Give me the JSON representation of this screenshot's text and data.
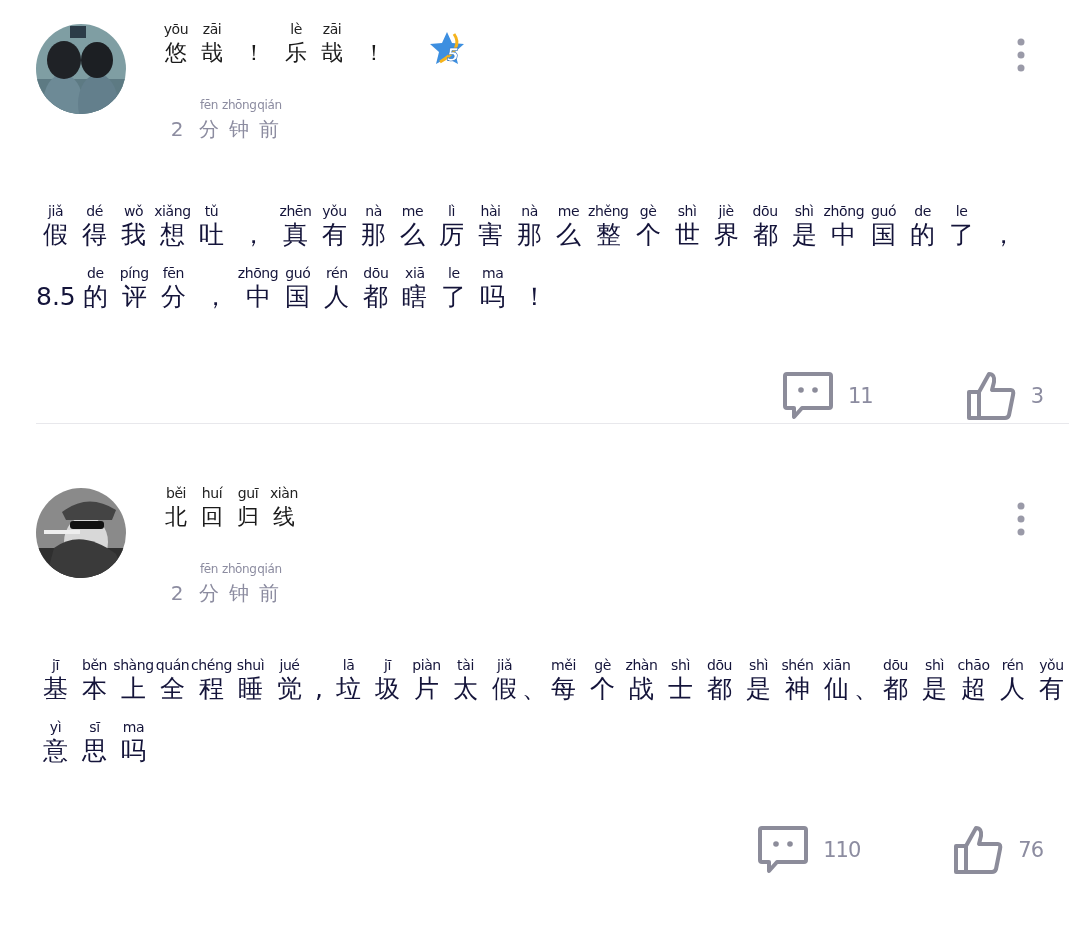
{
  "comments": [
    {
      "avatar": {
        "kind": "picture"
      },
      "name": [
        [
          "yōu",
          "悠"
        ],
        [
          "zāi",
          "哉"
        ],
        [
          "！"
        ],
        [
          "lè",
          "乐"
        ],
        [
          "zāi",
          "哉"
        ],
        [
          "！"
        ]
      ],
      "level_badge": "5",
      "time": [
        [
          "2"
        ],
        [
          "fēn",
          "分"
        ],
        [
          "zhōng",
          "钟"
        ],
        [
          "qián",
          "前"
        ]
      ],
      "text_lines": [
        [
          [
            "jiǎ",
            "假"
          ],
          [
            "dé",
            "得"
          ],
          [
            "wǒ",
            "我"
          ],
          [
            "xiǎng",
            "想"
          ],
          [
            "tǔ",
            "吐"
          ],
          [
            "，"
          ],
          [
            "zhēn",
            "真"
          ],
          [
            "yǒu",
            "有"
          ],
          [
            "nà",
            "那"
          ],
          [
            "me",
            "么"
          ],
          [
            "lì",
            "厉"
          ],
          [
            "hài",
            "害"
          ],
          [
            "nà",
            "那"
          ],
          [
            "me",
            "么"
          ],
          [
            "zhěng",
            "整"
          ],
          [
            "gè",
            "个"
          ],
          [
            "shì",
            "世"
          ],
          [
            "jiè",
            "界"
          ],
          [
            "dōu",
            "都"
          ],
          [
            "shì",
            "是"
          ],
          [
            "zhōng",
            "中"
          ],
          [
            "guó",
            "国"
          ],
          [
            "de",
            "的"
          ],
          [
            "le",
            "了"
          ],
          [
            "，"
          ]
        ],
        [
          [
            "8.5"
          ],
          [
            "de",
            "的"
          ],
          [
            "píng",
            "评"
          ],
          [
            "fēn",
            "分"
          ],
          [
            "，"
          ],
          [
            "zhōng",
            "中"
          ],
          [
            "guó",
            "国"
          ],
          [
            "rén",
            "人"
          ],
          [
            "dōu",
            "都"
          ],
          [
            "xiā",
            "瞎"
          ],
          [
            "le",
            "了"
          ],
          [
            "ma",
            "吗"
          ],
          [
            "！"
          ]
        ]
      ],
      "reply_count": "11",
      "like_count": "3"
    },
    {
      "avatar": {
        "kind": "picture"
      },
      "name": [
        [
          "běi",
          "北"
        ],
        [
          "huí",
          "回"
        ],
        [
          "guī",
          "归"
        ],
        [
          "xiàn",
          "线"
        ]
      ],
      "time": [
        [
          "2"
        ],
        [
          "fēn",
          "分"
        ],
        [
          "zhōng",
          "钟"
        ],
        [
          "qián",
          "前"
        ]
      ],
      "text_lines": [
        [
          [
            "jī",
            "基"
          ],
          [
            "běn",
            "本"
          ],
          [
            "shàng",
            "上"
          ],
          [
            "quán",
            "全"
          ],
          [
            "chéng",
            "程"
          ],
          [
            "shuì",
            "睡"
          ],
          [
            "jué",
            "觉"
          ],
          [
            ","
          ],
          [
            "lā",
            "垃"
          ],
          [
            "jī",
            "圾"
          ],
          [
            "piàn",
            "片"
          ],
          [
            "tài",
            "太"
          ],
          [
            "jiǎ",
            "假"
          ],
          [
            "、"
          ],
          [
            "měi",
            "每"
          ],
          [
            "gè",
            "个"
          ],
          [
            "zhàn",
            "战"
          ],
          [
            "shì",
            "士"
          ],
          [
            "dōu",
            "都"
          ],
          [
            "shì",
            "是"
          ],
          [
            "shén",
            "神"
          ],
          [
            "xiān",
            "仙"
          ],
          [
            "、"
          ],
          [
            "dōu",
            "都"
          ],
          [
            "shì",
            "是"
          ],
          [
            "chāo",
            "超"
          ],
          [
            "rén",
            "人"
          ],
          [
            "yǒu",
            "有"
          ]
        ],
        [
          [
            "yì",
            "意"
          ],
          [
            "sī",
            "思"
          ],
          [
            "ma",
            "吗"
          ]
        ]
      ],
      "reply_count": "110",
      "like_count": "76"
    }
  ]
}
